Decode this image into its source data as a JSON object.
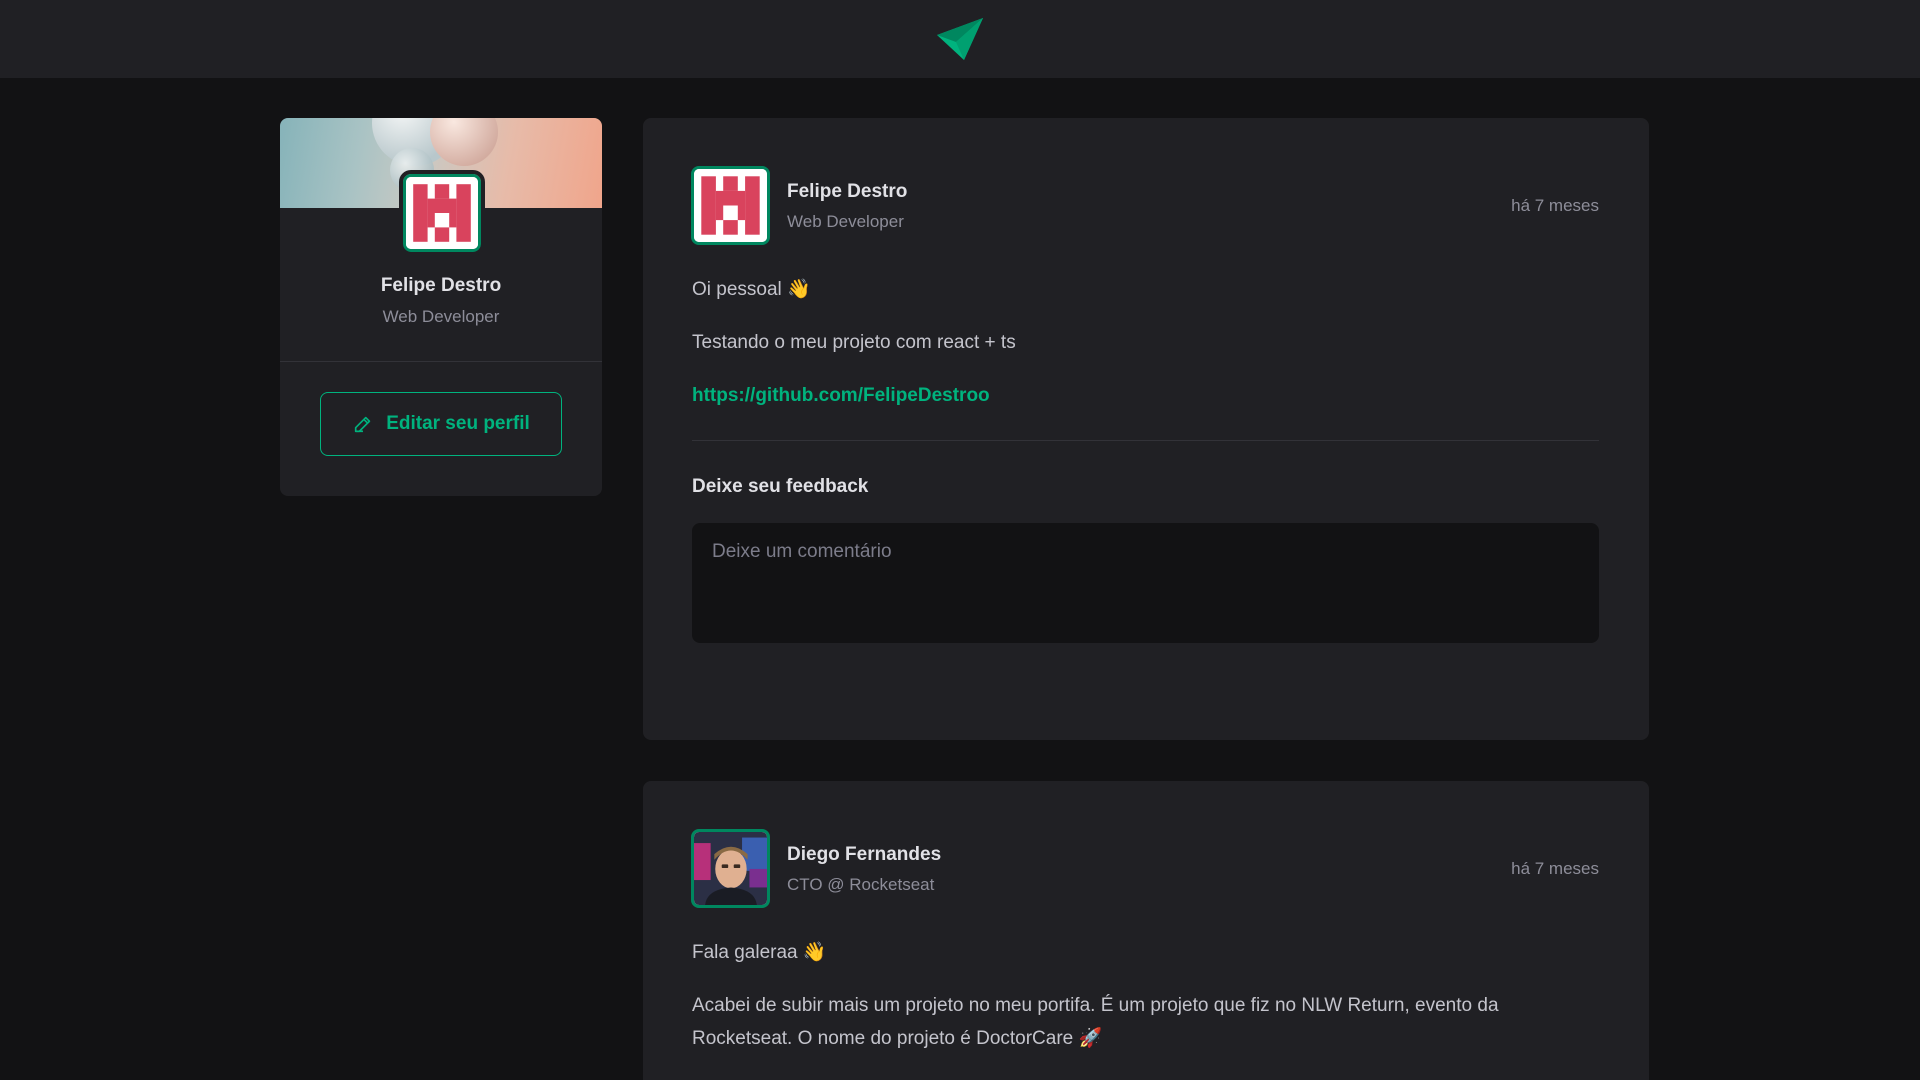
{
  "header": {
    "logo_icon": "paper-plane-icon"
  },
  "sidebar": {
    "name": "Felipe Destro",
    "role": "Web Developer",
    "edit_button_label": "Editar seu perfil",
    "edit_icon": "pencil-icon"
  },
  "posts": [
    {
      "author": "Felipe Destro",
      "role": "Web Developer",
      "time": "há 7 meses",
      "paragraphs": [
        "Oi pessoal 👋",
        "Testando o meu projeto com react + ts"
      ],
      "link": "https://github.com/FelipeDestroo",
      "feedback_title": "Deixe seu feedback",
      "comment_placeholder": "Deixe um comentário"
    },
    {
      "author": "Diego Fernandes",
      "role": "CTO @ Rocketseat",
      "time": "há 7 meses",
      "paragraphs": [
        "Fala galeraa 👋",
        "Acabei de subir mais um projeto no meu portifa. É um projeto que fiz no NLW Return, evento da Rocketseat. O nome do projeto é DoctorCare 🚀"
      ]
    }
  ],
  "colors": {
    "accent": "#00b37e",
    "accent_dark": "#00875f",
    "background": "#121214",
    "card": "#202024"
  }
}
